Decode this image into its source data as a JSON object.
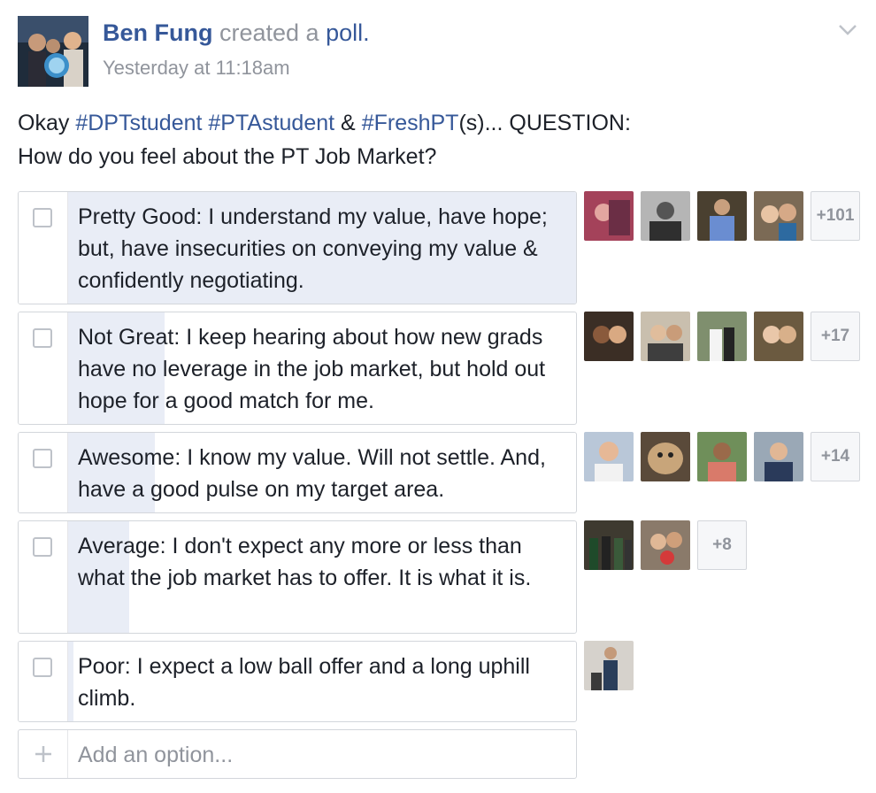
{
  "post": {
    "author": "Ben Fung",
    "action": "created a",
    "action_link": "poll.",
    "timestamp": "Yesterday at 11:18am",
    "body": {
      "prefix": "Okay",
      "tag1": "#DPTstudent",
      "tag2": "#PTAstudent",
      "amp": "&",
      "tag3": "#FreshPT",
      "suffix": "(s)... QUESTION:",
      "line2": "How do you feel about the PT Job Market?"
    }
  },
  "poll": {
    "options": [
      {
        "label": "Pretty Good: I understand my value, have hope; but, have insecurities on conveying my value & confidently negotiating.",
        "fill_fraction": 1.0,
        "more_voters": "+101"
      },
      {
        "label": "Not Great: I keep hearing about how new grads have no leverage in the job market, but hold out hope for a good match for me.",
        "fill_fraction": 0.19,
        "more_voters": "+17"
      },
      {
        "label": "Awesome: I know my value. Will not settle. And, have a good pulse on my target area.",
        "fill_fraction": 0.17,
        "more_voters": "+14"
      },
      {
        "label": "Average: I don't expect any more or less than what the job market has to offer. It is what it is.",
        "fill_fraction": 0.12,
        "more_voters": "+8"
      },
      {
        "label": "Poor: I expect a low ball offer and a long uphill climb.",
        "fill_fraction": 0.01,
        "more_voters": ""
      }
    ],
    "add_option_placeholder": "Add an option..."
  },
  "colors": {
    "link": "#365899",
    "muted": "#90949c",
    "bar_fill": "#e9edf6",
    "border": "#d3d6db"
  },
  "icons": {
    "menu": "chevron-down-icon",
    "add": "plus-icon"
  }
}
